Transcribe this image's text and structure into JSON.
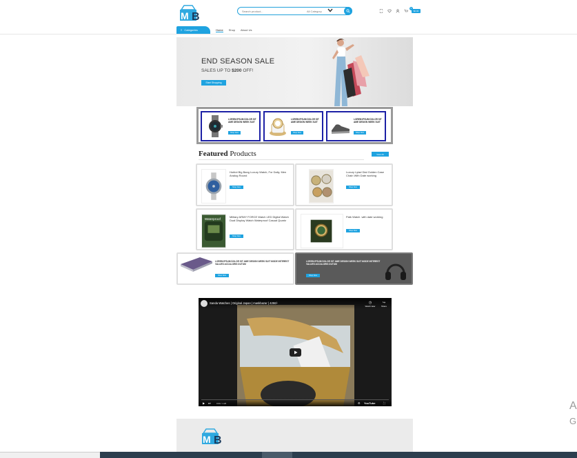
{
  "header": {
    "logo_text": "MB",
    "search_placeholder": "Search product...",
    "search_category": "All Category",
    "cart_label": "$0.00",
    "cart_count": "0"
  },
  "nav": {
    "categories_label": "Categories",
    "items": [
      "Home",
      "Shop",
      "About Us"
    ]
  },
  "hero": {
    "title": "END SEASON SALE",
    "subtitle_prefix": "SALES UP TO ",
    "subtitle_amount": "$200",
    "subtitle_suffix": " OFF!",
    "button": "Start Shopping"
  },
  "promos": [
    {
      "text": "LOREM IPSUM DOLOR SIT AME DESIGN WEEK SUIT",
      "button": "Shop Now"
    },
    {
      "text": "LOREM IPSUM DOLOR SIT AME DESIGN WEEK SUIT",
      "button": "Shop Now"
    },
    {
      "text": "LOREM IPSUM DOLOR SIT AME DESIGN WEEK SUIT",
      "button": "Shop Now"
    }
  ],
  "featured": {
    "title_bold": "Featured",
    "title_rest": " Products",
    "view_all": "View All"
  },
  "products": [
    {
      "name": "Hublot Big Bang Luxury Watch, For Daily, Men Analog Round",
      "button": "Shop Now"
    },
    {
      "name": "Luxury Lylad Dial Golden Case Chain With Date working",
      "button": "Shop Now"
    },
    {
      "name": "Military ARMY FORCE Watch LED Digital Watch Dual Display Watch Waterproof Casual Quartz",
      "button": "Shop Now"
    },
    {
      "name": "Patk Watch ⁣ with date working",
      "button": "Shop Now"
    }
  ],
  "wide_promos": [
    {
      "text": "LOREM IPSUM DOLOR SIT AME DESIGN WEEK SUIT MODE INTEREST VALUES ACCALORIS DUTUM",
      "button": "Shop Now"
    },
    {
      "text": "LOREM IPSUM DOLOR SIT AME DESIGN WEEK SUIT MODE INTEREST VALUES ACCALORIS DUTUM",
      "button": "Shop Now"
    }
  ],
  "video": {
    "title": "Sanda Watches | Original Japan | maskbazar | 4250/-",
    "watch_later": "Watch later",
    "share": "Share",
    "time": "0:00 / 1:26",
    "brand": "YouTube"
  },
  "side": {
    "a": "A",
    "g": "G"
  },
  "colors": {
    "accent": "#1fa3e0",
    "promo_border": "#1b1fa5",
    "dark_card": "#5a5a5a"
  }
}
